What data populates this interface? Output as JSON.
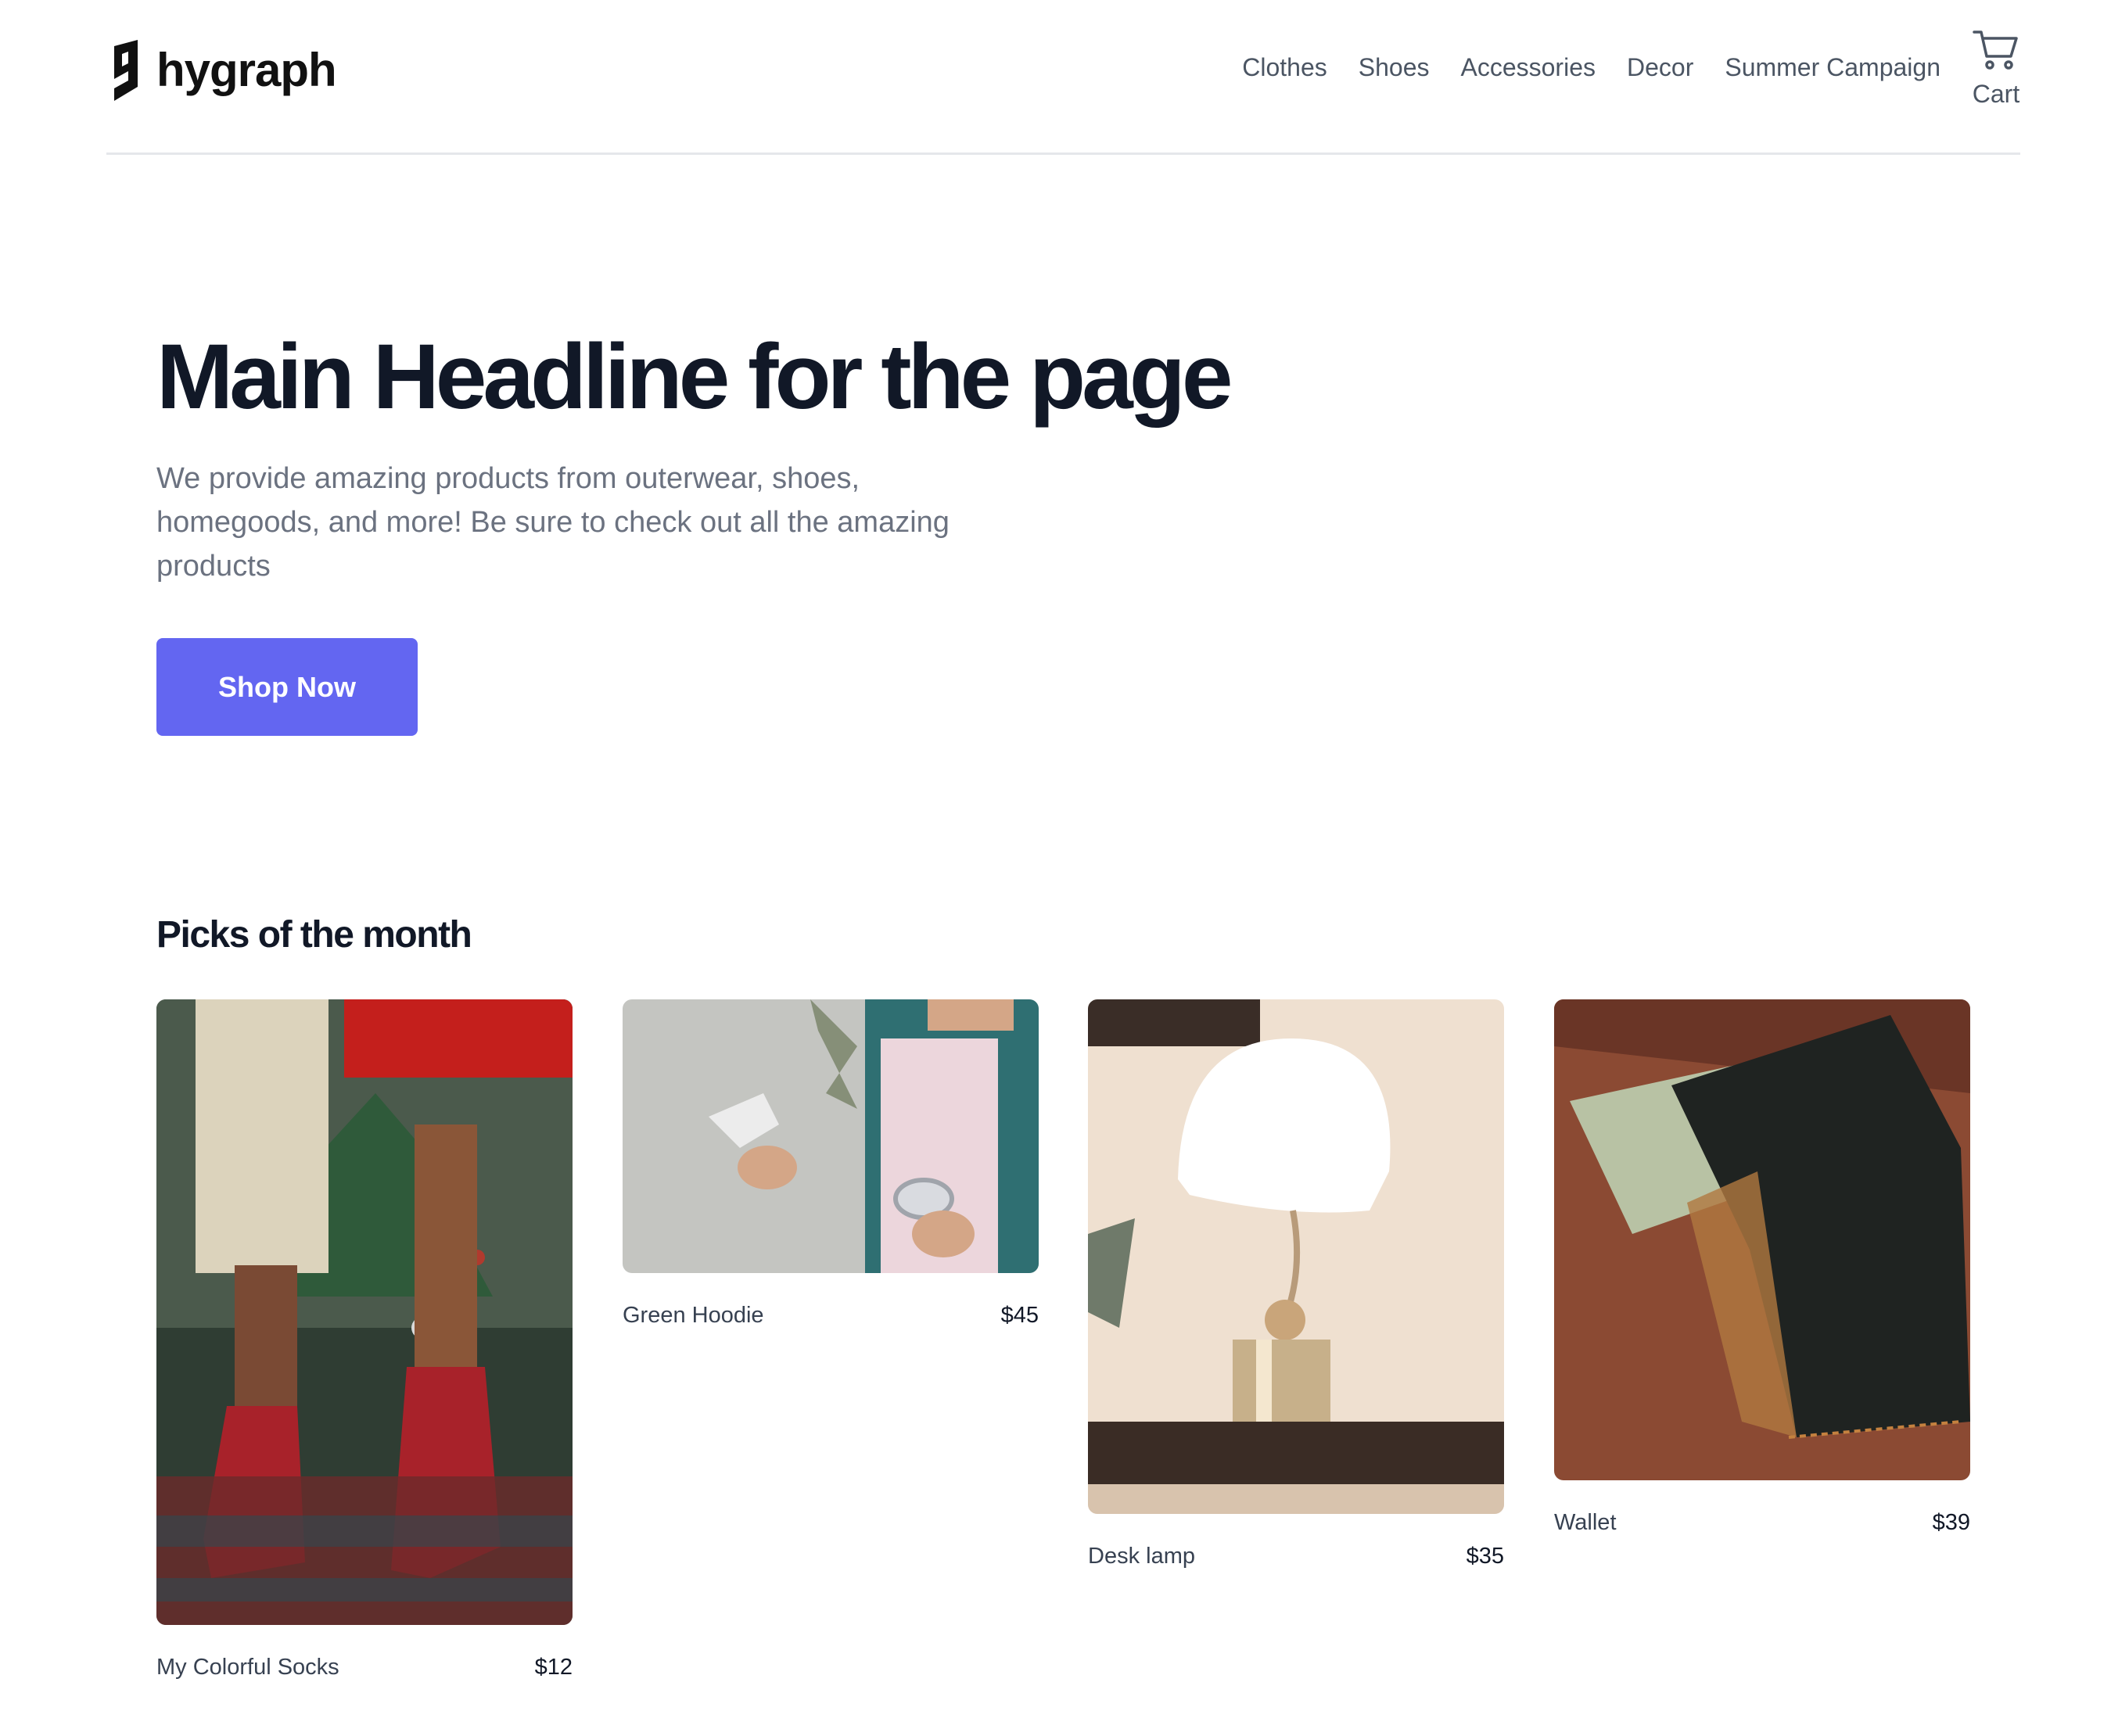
{
  "brand": {
    "name": "hygraph",
    "logo_icon": "hygraph-logo-icon"
  },
  "nav": {
    "links": [
      "Clothes",
      "Shoes",
      "Accessories",
      "Decor",
      "Summer Campaign"
    ],
    "cart_label": "Cart",
    "cart_icon": "cart-icon"
  },
  "hero": {
    "title": "Main Headline for the page",
    "description": "We provide amazing products from outerwear, shoes, homegoods, and more! Be sure to check out all the amazing products",
    "cta_label": "Shop Now"
  },
  "picks": {
    "title": "Picks of the month",
    "products": [
      {
        "name": "My Colorful Socks",
        "price": "$12",
        "image": "socks-photo"
      },
      {
        "name": "Green Hoodie",
        "price": "$45",
        "image": "hoodie-photo"
      },
      {
        "name": "Desk lamp",
        "price": "$35",
        "image": "lamp-photo"
      },
      {
        "name": "Wallet",
        "price": "$39",
        "image": "wallet-photo"
      }
    ]
  },
  "colors": {
    "accent": "#6366f1",
    "text_dark": "#111827",
    "text_muted": "#6b7280",
    "nav_text": "#4b5563",
    "divider": "#e5e7eb"
  }
}
